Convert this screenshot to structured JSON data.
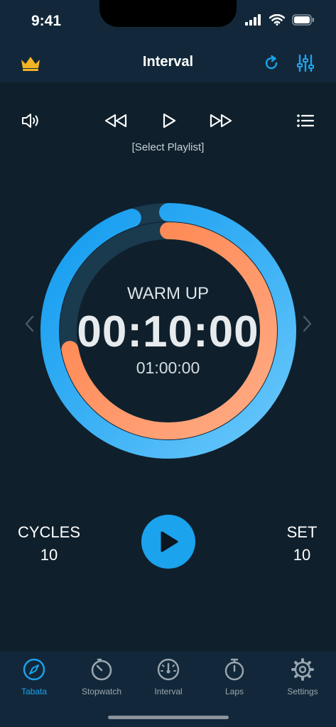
{
  "status": {
    "time": "9:41"
  },
  "header": {
    "title": "Interval",
    "premium_icon": "crown-icon",
    "reset_icon": "refresh-icon",
    "settings_icon": "sliders-icon"
  },
  "media": {
    "volume_icon": "speaker-icon",
    "rewind_icon": "rewind-icon",
    "play_icon": "play-icon",
    "forward_icon": "fast-forward-icon",
    "list_icon": "list-icon",
    "playlist_label": "[Select Playlist]"
  },
  "timer": {
    "phase": "WARM UP",
    "current": "00:10:00",
    "total": "01:00:00",
    "outer_progress": 0.95,
    "inner_progress": 0.72,
    "colors": {
      "outer": "#1ba3ed",
      "inner": "#ff8c55",
      "track": "#1a3a4e"
    }
  },
  "stats": {
    "cycles_label": "CYCLES",
    "cycles_value": "10",
    "set_label": "SET",
    "set_value": "10"
  },
  "tabs": [
    {
      "label": "Tabata",
      "icon": "compass-icon",
      "active": true
    },
    {
      "label": "Stopwatch",
      "icon": "stopwatch-icon",
      "active": false
    },
    {
      "label": "Interval",
      "icon": "gauge-icon",
      "active": false
    },
    {
      "label": "Laps",
      "icon": "timer-icon",
      "active": false
    },
    {
      "label": "Settings",
      "icon": "gear-icon",
      "active": false
    }
  ],
  "colors": {
    "accent": "#1ba3ed",
    "gold": "#f5b324",
    "background": "#0f202c"
  }
}
